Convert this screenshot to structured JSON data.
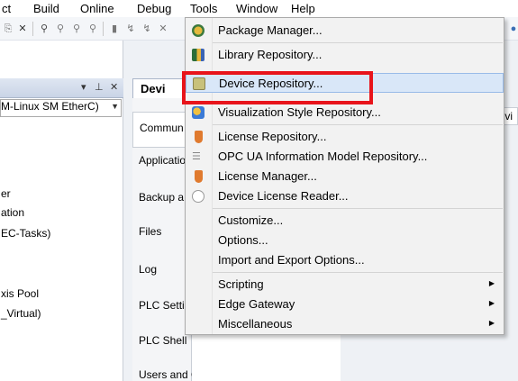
{
  "menubar": {
    "items": [
      "ct",
      "Build",
      "Online",
      "Debug",
      "Tools",
      "Window",
      "Help"
    ]
  },
  "left_panel": {
    "items": [
      "M-Linux SM EtherC)",
      "er",
      "ation",
      "EC-Tasks)",
      "xis Pool",
      "_Virtual)"
    ]
  },
  "editor": {
    "device_tab": "Devi",
    "vertical_tabs": [
      "Commun",
      "Applicatio",
      "Backup a",
      "Files",
      "Log",
      "PLC Setti",
      "PLC Shell",
      "Users and Groups"
    ],
    "right_strip": "Devi"
  },
  "tools_menu": {
    "items": [
      {
        "label": "Package Manager...",
        "icon": "package-icon"
      },
      {
        "label": "Library Repository...",
        "icon": "library-icon"
      },
      {
        "label": "Device Repository...",
        "icon": "device-icon"
      },
      {
        "label": "Visualization Style Repository...",
        "icon": "visualization-icon"
      },
      {
        "label": "License Repository...",
        "icon": "license-icon"
      },
      {
        "label": "OPC UA Information Model Repository...",
        "icon": "opcua-icon"
      },
      {
        "label": "License Manager...",
        "icon": "license-icon"
      },
      {
        "label": "Device License Reader...",
        "icon": "reader-icon"
      },
      {
        "label": "Customize..."
      },
      {
        "label": "Options..."
      },
      {
        "label": "Import and Export Options..."
      },
      {
        "label": "Scripting",
        "submenu": true
      },
      {
        "label": "Edge Gateway",
        "submenu": true
      },
      {
        "label": "Miscellaneous",
        "submenu": true
      }
    ]
  },
  "colors": {
    "highlight_border": "#e8141b",
    "hover_bg": "#d9e7f8"
  }
}
